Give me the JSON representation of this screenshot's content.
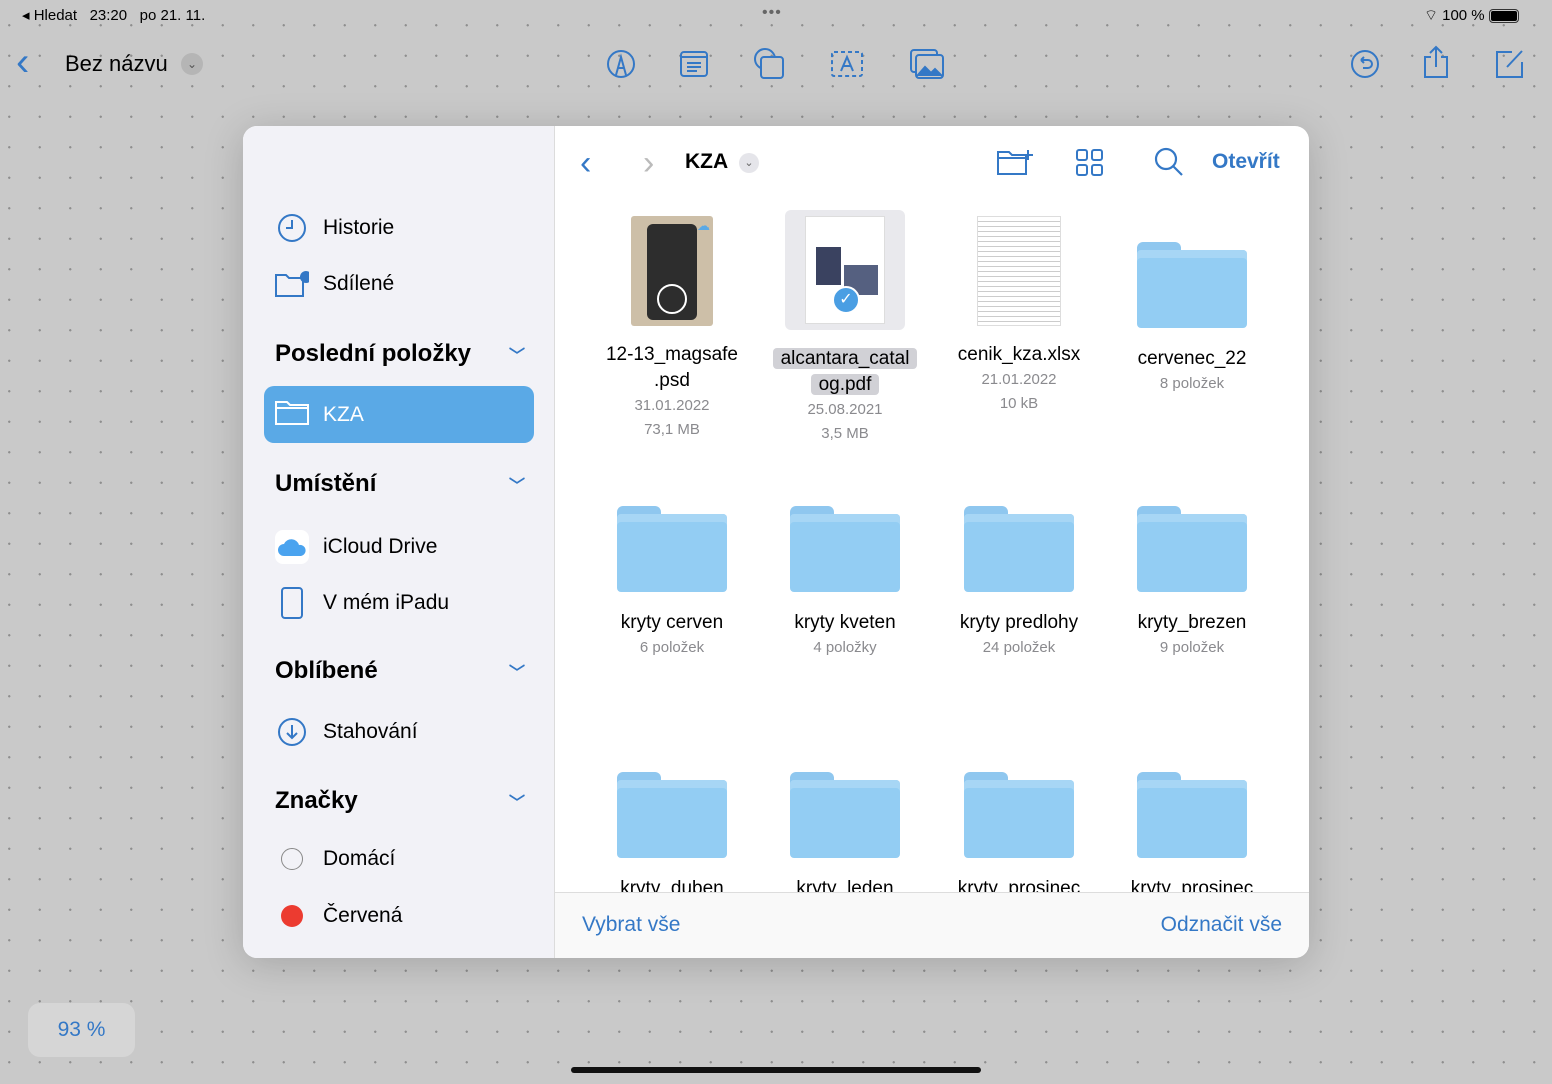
{
  "status": {
    "back": "◂ Hledat",
    "time": "23:20",
    "date": "po 21. 11.",
    "battery": "100 %"
  },
  "toolbar": {
    "back": "‹",
    "title": "Bez názvu"
  },
  "zoom": "93 %",
  "sidebar": {
    "top": [
      {
        "label": "Historie",
        "icon": "clock-icon"
      },
      {
        "label": "Sdílené",
        "icon": "shared-folder-icon"
      }
    ],
    "sections": [
      {
        "title": "Poslední položky",
        "items": [
          {
            "label": "KZA",
            "selected": true
          }
        ]
      },
      {
        "title": "Umístění",
        "items": [
          {
            "label": "iCloud Drive"
          },
          {
            "label": "V mém iPadu"
          }
        ]
      },
      {
        "title": "Oblíbené",
        "items": [
          {
            "label": "Stahování"
          }
        ]
      },
      {
        "title": "Značky",
        "items": [
          {
            "label": "Domácí"
          },
          {
            "label": "Červená"
          }
        ]
      }
    ]
  },
  "browser": {
    "folder": "KZA",
    "open": "Otevřít",
    "select_all": "Vybrat vše",
    "deselect_all": "Odznačit vše",
    "items": [
      {
        "name": "12-13_magsafe .psd",
        "type": "psd",
        "meta1": "31.01.2022",
        "meta2": "73,1 MB"
      },
      {
        "name": "alcantara_catal og.pdf",
        "type": "pdf",
        "meta1": "25.08.2021",
        "meta2": "3,5 MB",
        "selected": true
      },
      {
        "name": "cenik_kza.xlsx",
        "type": "xlsx",
        "meta1": "21.01.2022",
        "meta2": "10 kB"
      },
      {
        "name": "cervenec_22",
        "type": "folder",
        "meta1": "8 položek"
      },
      {
        "name": "kryty cerven",
        "type": "folder",
        "meta1": "6 položek"
      },
      {
        "name": "kryty kveten",
        "type": "folder",
        "meta1": "4 položky"
      },
      {
        "name": "kryty predlohy",
        "type": "folder",
        "meta1": "24 položek"
      },
      {
        "name": "kryty_brezen",
        "type": "folder",
        "meta1": "9 položek"
      },
      {
        "name": "kryty_duben",
        "type": "folder"
      },
      {
        "name": "kryty_leden",
        "type": "folder"
      },
      {
        "name": "kryty_prosinec",
        "type": "folder"
      },
      {
        "name": "kryty_prosinec",
        "type": "folder"
      }
    ]
  }
}
